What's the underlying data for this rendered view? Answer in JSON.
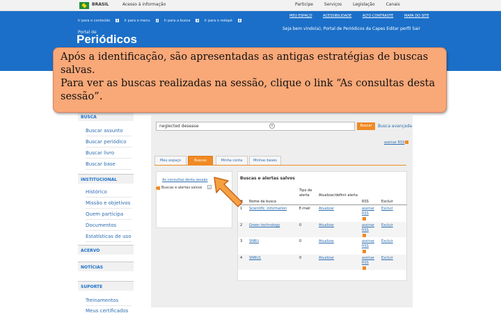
{
  "gov_bar": {
    "brasil": "BRASIL",
    "acesso": "Acesso à informação",
    "links": [
      "Participe",
      "Serviços",
      "Legislação",
      "Canais"
    ]
  },
  "header": {
    "skip_links": [
      {
        "label": "Ir para o conteúdo",
        "key": "1"
      },
      {
        "label": "Ir para o menu",
        "key": "2"
      },
      {
        "label": "Ir para a busca",
        "key": "3"
      },
      {
        "label": "Ir para o rodapé",
        "key": "4"
      }
    ],
    "portal_small": "Portal de",
    "portal_title": "Periódicos",
    "top_links": [
      "MEU ESPAÇO",
      "ACESSIBILIDADE",
      "ALTO CONTRASTE",
      "MAPA DO SITE"
    ],
    "welcome": "Seja bem vindo(a), Portal de Periódicos da Capes   Editar perfil  Sair"
  },
  "callout": {
    "line1": "Após a identificação, são apresentadas as antigas estratégias de buscas salvas.",
    "line2": "Para ver as buscas realizadas na sessão,  clique o link  “As consultas desta sessão”."
  },
  "sidebar": {
    "busca_head": "BUSCA",
    "busca_items": [
      "Buscar assunto",
      "Buscar periódico",
      "Buscar livro",
      "Buscar base"
    ],
    "institucional_head": "INSTITUCIONAL",
    "institucional_items": [
      "Histórico",
      "Missão e objetivos",
      "Quem participa",
      "Documentos",
      "Estatísticas de uso"
    ],
    "acervo_head": "ACERVO",
    "noticias_head": "NOTÍCIAS",
    "suporte_head": "SUPORTE",
    "suporte_items": [
      "Treinamentos",
      "Meus certificados"
    ]
  },
  "search": {
    "query": "neglected desease",
    "button": "Buscar",
    "advanced": "Busca avançada",
    "rss": "assinar RSS"
  },
  "tabs": [
    "Meu espaço",
    "Buscas",
    "Minha conta",
    "Minhas bases"
  ],
  "left_box": {
    "session_link": "As consultas desta sessão",
    "saved": "Buscas e alertas salvos"
  },
  "results": {
    "title": "Buscas e alertas salvos",
    "headers": {
      "num": "#",
      "name": "Nome da busca",
      "type": "Tipo de alerta",
      "update": "Atualizar/definir alerta",
      "rss": "RSS",
      "delete": "Excluir"
    },
    "rows": [
      {
        "num": "1",
        "name": "Scientific_Information",
        "type": "E-mail",
        "update": "Atualizar",
        "rss": "assinar RSS",
        "delete": "Excluir"
      },
      {
        "num": "2",
        "name": "Green technology",
        "type": "0",
        "update": "Atualizar",
        "rss": "assinar RSS",
        "delete": "Excluir"
      },
      {
        "num": "3",
        "name": "SNBU",
        "type": "0",
        "update": "Atualizar",
        "rss": "assinar RSS",
        "delete": "Excluir"
      },
      {
        "num": "4",
        "name": "SNBU1",
        "type": "0",
        "update": "Atualizar",
        "rss": "assinar RSS",
        "delete": "Excluir"
      }
    ]
  },
  "colors": {
    "header_blue": "#1b6fc8",
    "accent_orange": "#f08a24",
    "callout_fill": "#f9a878"
  }
}
